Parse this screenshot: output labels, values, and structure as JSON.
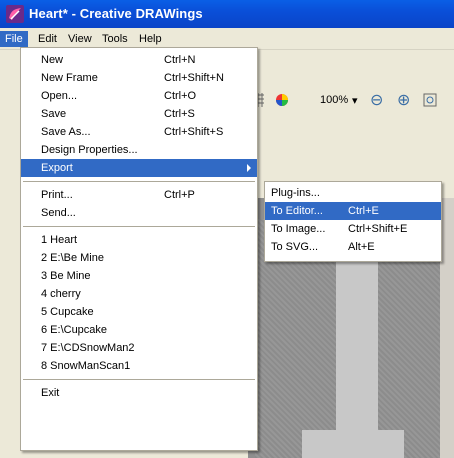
{
  "window": {
    "title": "Heart* - Creative DRAWings"
  },
  "menubar": {
    "items": [
      "File",
      "Edit",
      "View",
      "Tools",
      "Help"
    ]
  },
  "toolbar": {
    "zoom_value": "100%",
    "zoom_arrow": "▾",
    "zoom_out_glyph": "⊖",
    "zoom_in_glyph": "⊕"
  },
  "file_menu": {
    "new": {
      "label": "New",
      "shortcut": "Ctrl+N"
    },
    "new_frame": {
      "label": "New Frame",
      "shortcut": "Ctrl+Shift+N"
    },
    "open": {
      "label": "Open...",
      "shortcut": "Ctrl+O"
    },
    "save": {
      "label": "Save",
      "shortcut": "Ctrl+S"
    },
    "save_as": {
      "label": "Save As...",
      "shortcut": "Ctrl+Shift+S"
    },
    "design_properties": {
      "label": "Design Properties..."
    },
    "export": {
      "label": "Export"
    },
    "print": {
      "label": "Print...",
      "shortcut": "Ctrl+P"
    },
    "send": {
      "label": "Send..."
    },
    "recent": [
      "1 Heart",
      "2 E:\\Be Mine",
      "3 Be Mine",
      "4 cherry",
      "5 Cupcake",
      "6 E:\\Cupcake",
      "7 E:\\CDSnowMan2",
      "8 SnowManScan1"
    ],
    "exit": {
      "label": "Exit"
    }
  },
  "export_menu": {
    "plugins": {
      "label": "Plug-ins..."
    },
    "to_editor": {
      "label": "To Editor...",
      "shortcut": "Ctrl+E"
    },
    "to_image": {
      "label": "To Image...",
      "shortcut": "Ctrl+Shift+E"
    },
    "to_svg": {
      "label": "To SVG...",
      "shortcut": "Alt+E"
    }
  },
  "colors": {
    "titlebar": "#0a4fd8",
    "highlight": "#316ac5",
    "menu_bg": "#ffffff",
    "chrome": "#ece9d8"
  }
}
